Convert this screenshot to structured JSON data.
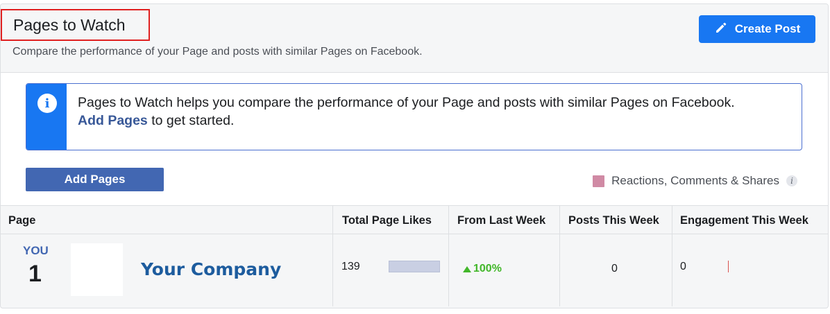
{
  "header": {
    "title": "Pages to Watch",
    "subtitle": "Compare the performance of your Page and posts with similar Pages on Facebook.",
    "create_post_label": "Create Post",
    "create_post_icon": "pencil-icon"
  },
  "info": {
    "icon": "info-icon",
    "text": "Pages to Watch helps you compare the performance of your Page and posts with similar Pages on Facebook.",
    "link_label": "Add Pages",
    "link_suffix": "to get started."
  },
  "actions": {
    "add_pages_label": "Add Pages"
  },
  "legend": {
    "label": "Reactions, Comments & Shares",
    "swatch_color": "#d08aa4"
  },
  "table": {
    "columns": [
      "Page",
      "Total Page Likes",
      "From Last Week",
      "Posts This Week",
      "Engagement This Week"
    ],
    "rows": [
      {
        "badge": "YOU",
        "rank": "1",
        "name": "Your Company",
        "total_likes": "139",
        "change": "100%",
        "change_direction": "up",
        "posts": "0",
        "engagement": "0"
      }
    ]
  },
  "colors": {
    "primary": "#1877f2",
    "button": "#4267b2",
    "positive": "#42b72a",
    "highlight_border": "#e02020"
  }
}
